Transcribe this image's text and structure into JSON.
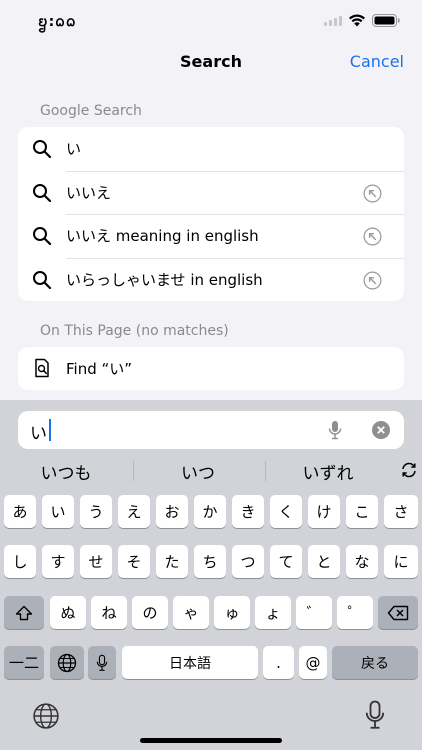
{
  "status": {
    "time": "ᨮ:ᨵᨵ"
  },
  "nav": {
    "title": "Search",
    "cancel": "Cancel"
  },
  "google": {
    "header": "Google Search",
    "items": [
      {
        "text": "い",
        "arrow": false
      },
      {
        "text": "いいえ",
        "arrow": true
      },
      {
        "text": "いいえ meaning in english",
        "arrow": true
      },
      {
        "text": "いらっしゃいませ in english",
        "arrow": true
      }
    ]
  },
  "page": {
    "header": "On This Page (no matches)",
    "find_label": "Find “い”"
  },
  "input": {
    "value": "い"
  },
  "candidates": [
    "いつも",
    "いつ",
    "いずれ"
  ],
  "keyboard": {
    "row1": [
      "あ",
      "い",
      "う",
      "え",
      "お",
      "か",
      "き",
      "く",
      "け",
      "こ",
      "さ"
    ],
    "row2": [
      "し",
      "す",
      "せ",
      "そ",
      "た",
      "ち",
      "つ",
      "て",
      "と",
      "な",
      "に"
    ],
    "row3": [
      "ぬ",
      "ね",
      "の",
      "ゃ",
      "ゅ",
      "ょ",
      "゛",
      "゜"
    ],
    "row4": {
      "mode": "一二",
      "space": "日本語",
      "period": ".",
      "at": "@",
      "return": "戻る"
    }
  },
  "icons": {
    "search": "search-icon",
    "arrow": "arrow-up-left-icon",
    "find": "find-in-page-icon",
    "mic": "microphone-icon",
    "clear": "clear-icon",
    "shift": "shift-icon",
    "backspace": "backspace-icon",
    "globe": "globe-icon",
    "refresh": "refresh-icon"
  },
  "colors": {
    "accent": "#1a73e8",
    "background": "#f2f2f7",
    "keyboard": "#d1d3d9"
  }
}
